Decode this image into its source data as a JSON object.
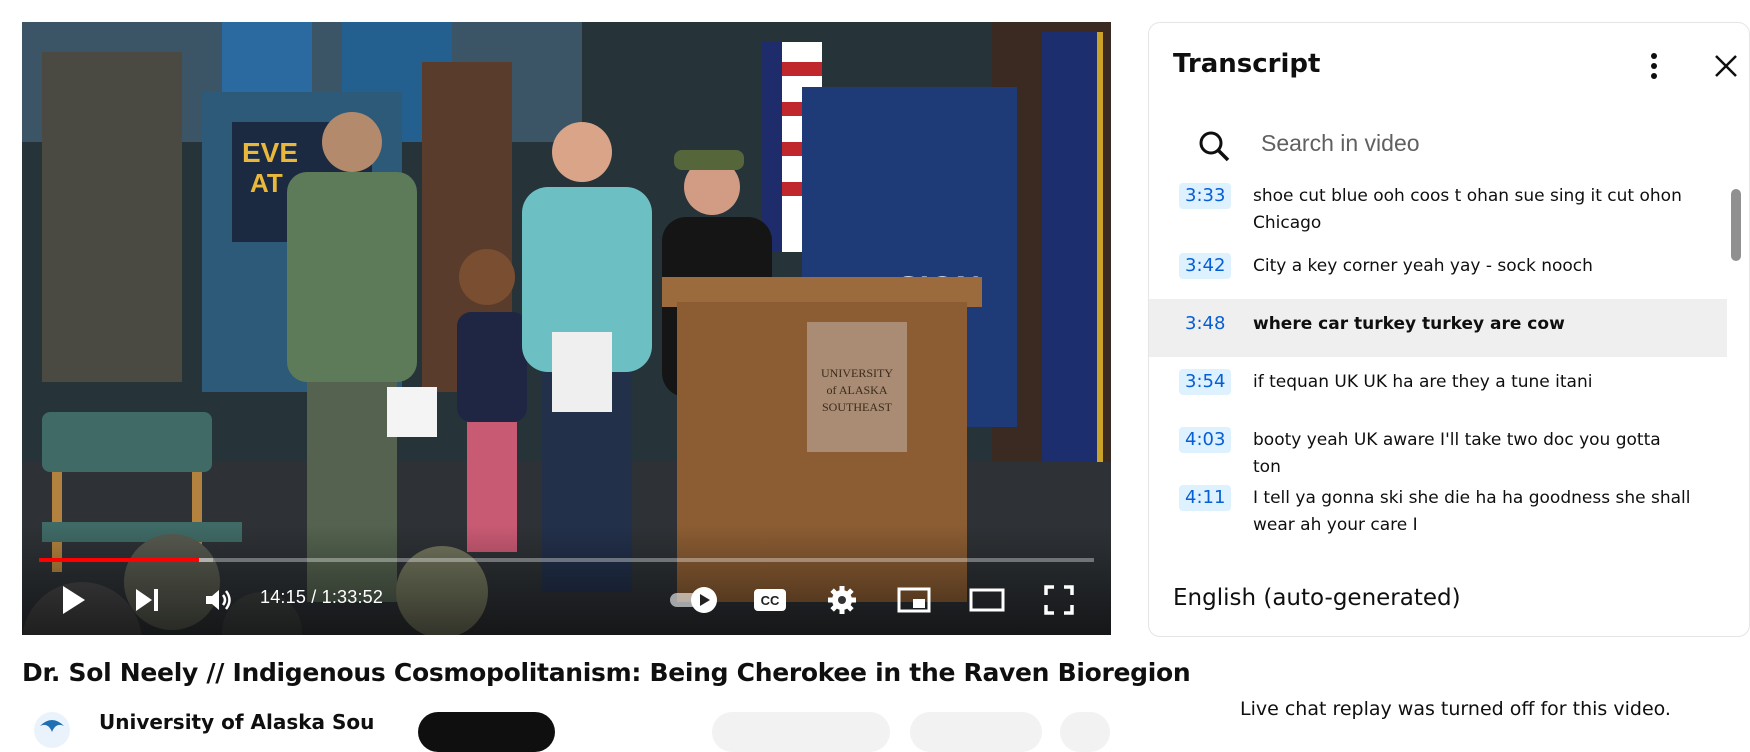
{
  "player": {
    "time": "14:15 / 1:33:52",
    "progress_fraction": 0.152,
    "buffered_fraction": 0.165,
    "icons": [
      "play-icon",
      "next-icon",
      "volume-icon",
      "autoplay-toggle-icon",
      "captions-icon",
      "settings-icon",
      "miniplayer-icon",
      "theater-icon",
      "fullscreen-icon"
    ],
    "accent": "#ff0000"
  },
  "video": {
    "title": "Dr. Sol Neely // Indigenous Cosmopolitanism: Being Cherokee in the Raven Bioregion",
    "channel": "University of Alaska Sou"
  },
  "transcript": {
    "title": "Transcript",
    "search_placeholder": "Search in video",
    "language": "English (auto-generated)",
    "segments": [
      {
        "time": "3:33",
        "text": "shoe cut blue ooh coos t ohan sue sing it cut ohon Chicago"
      },
      {
        "time": "3:42",
        "text": "City a key corner yeah yay - sock nooch"
      },
      {
        "time": "3:48",
        "text": "where car turkey turkey are cow",
        "active": true
      },
      {
        "time": "3:54",
        "text": "if tequan UK UK ha are they a tune itani"
      },
      {
        "time": "4:03",
        "text": "booty yeah UK aware I'll take two doc you gotta ton"
      },
      {
        "time": "4:11",
        "text": "I tell ya gonna ski she die ha ha goodness she shall wear ah your care I"
      }
    ],
    "timestamp_bg": "#def1ff",
    "timestamp_color": "#065fd4"
  },
  "live_chat": {
    "note": "Live chat replay was turned off for this video."
  }
}
